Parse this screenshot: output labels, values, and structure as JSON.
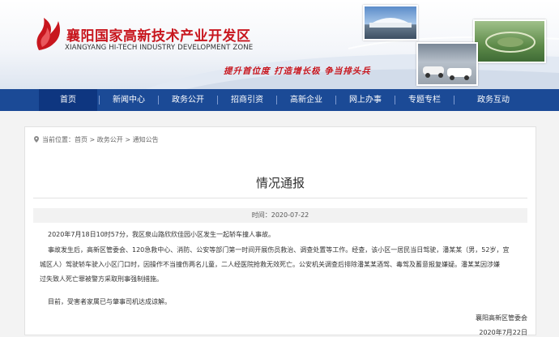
{
  "header": {
    "title_cn": "襄阳国家高新技术产业开发区",
    "title_en": "XIANGYANG HI-TECH INDUSTRY DEVELOPMENT ZONE",
    "slogan": "提升首位度  打造增长极  争当排头兵",
    "colors": {
      "brand_red": "#c8161e",
      "nav_blue": "#1b4a96",
      "nav_active": "#0e3680"
    }
  },
  "nav": {
    "items": [
      {
        "label": "首页"
      },
      {
        "label": "新闻中心"
      },
      {
        "label": "政务公开"
      },
      {
        "label": "招商引资"
      },
      {
        "label": "高新企业"
      },
      {
        "label": "网上办事"
      },
      {
        "label": "专题专栏"
      },
      {
        "label": "政务互动"
      }
    ],
    "active_index": 0
  },
  "breadcrumb": {
    "prefix": "当前位置：",
    "items": [
      "首页",
      "政务公开",
      "通知公告"
    ],
    "separator": " > "
  },
  "article": {
    "title": "情况通报",
    "meta_label": "时间：",
    "meta_value": "2020-07-22",
    "paragraphs": [
      "2020年7月18日10时57分，我区泉山路欣欣佳园小区发生一起轿车撞人事故。",
      "事故发生后，高新区管委会、120急救中心、消防、公安等部门第一时间开展伤员救治、调查处置等工作。经查，该小区一居民当日驾驶，潘某某（男，52岁，宜",
      "城区人）驾驶轿车驶入小区门口时，因操作不当撞伤两名儿童，二人经医院抢救无效死亡。公安机关调查后排除潘某某酒驾、毒驾及蓄意报复嫌疑。潘某某因涉嫌",
      "过失致人死亡罪被警方采取刑事强制措施。",
      "目前，受害者家属已与肇事司机达成谅解。"
    ],
    "signature_org": "襄阳高新区管委会",
    "signature_date": "2020年7月22日"
  }
}
